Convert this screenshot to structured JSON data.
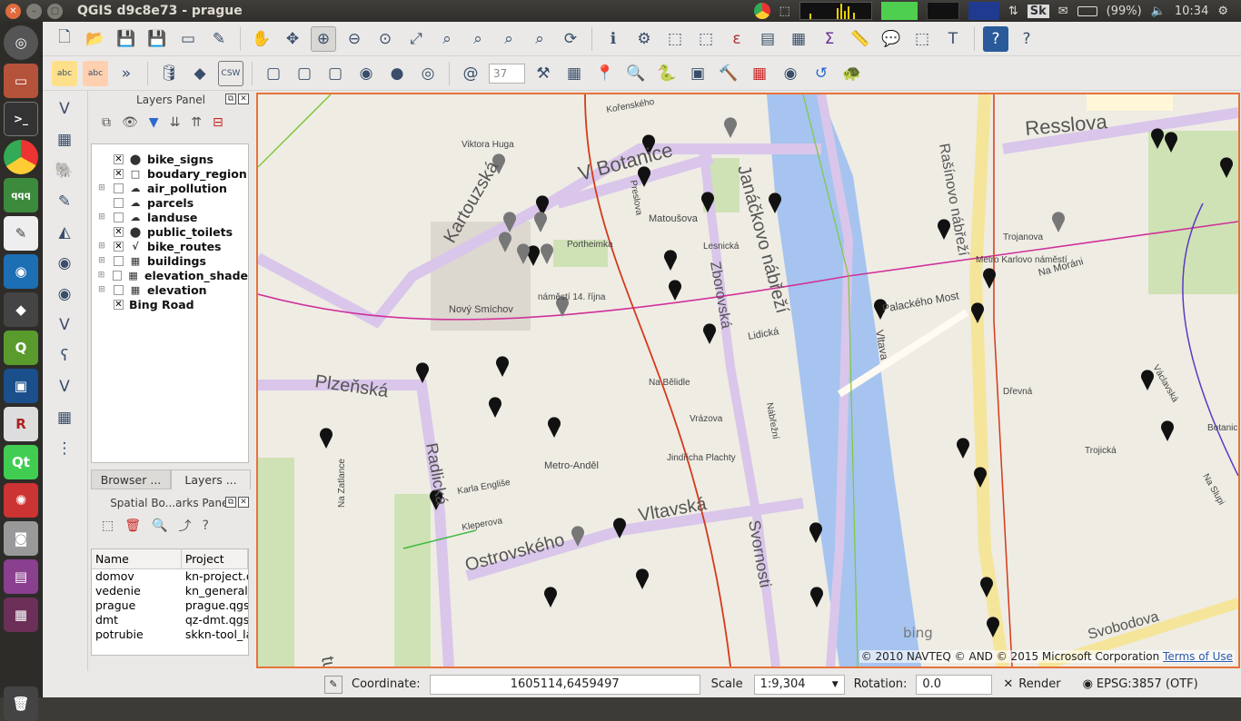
{
  "window": {
    "title": "QGIS d9c8e73 - prague"
  },
  "tray": {
    "battery": "(99%)",
    "time": "10:34",
    "sk_label": "Sk"
  },
  "launcher": {
    "items": [
      "dash-home",
      "files",
      "terminal",
      "chrome",
      "docs",
      "editor",
      "network",
      "vscode",
      "qgis",
      "virtualbox",
      "r",
      "qt",
      "gimp",
      "settings",
      "apps",
      "workspace",
      "trash"
    ]
  },
  "toolbar": {
    "zoom_value": "37"
  },
  "layers_panel": {
    "title": "Layers Panel",
    "layers": [
      {
        "name": "bike_signs",
        "checked": true,
        "icon": "marker-icon",
        "expand": false
      },
      {
        "name": "boudary_region",
        "checked": true,
        "icon": "polygon-outline-icon",
        "expand": false
      },
      {
        "name": "air_pollution",
        "checked": false,
        "icon": "polygon-icon",
        "expand": true
      },
      {
        "name": "parcels",
        "checked": false,
        "icon": "polygon-icon",
        "expand": false
      },
      {
        "name": "landuse",
        "checked": false,
        "icon": "polygon-icon",
        "expand": true
      },
      {
        "name": "public_toilets",
        "checked": true,
        "icon": "marker-icon",
        "expand": false
      },
      {
        "name": "bike_routes",
        "checked": true,
        "icon": "line-icon",
        "expand": true
      },
      {
        "name": "buildings",
        "checked": false,
        "icon": "raster-icon",
        "expand": true
      },
      {
        "name": "elevation_shade",
        "checked": false,
        "icon": "raster-icon",
        "expand": true
      },
      {
        "name": "elevation",
        "checked": false,
        "icon": "raster-icon",
        "expand": true
      },
      {
        "name": "Bing Road",
        "checked": true,
        "icon": "",
        "expand": false
      }
    ]
  },
  "panel_tabs": {
    "browser": "Browser ...",
    "layers": "Layers ..."
  },
  "bookmarks_panel": {
    "title": "Spatial Bo...arks Panel",
    "col_name": "Name",
    "col_project": "Project",
    "rows": [
      {
        "name": "domov",
        "project": "kn-project.q"
      },
      {
        "name": "vedenie",
        "project": "kn_general_"
      },
      {
        "name": "prague",
        "project": "prague.qgs"
      },
      {
        "name": "dmt",
        "project": "qz-dmt.qgs"
      },
      {
        "name": "potrubie",
        "project": "skkn-tool_la"
      }
    ]
  },
  "map": {
    "attribution": "© 2010 NAVTEQ © AND © 2015 Microsoft Corporation",
    "terms": "Terms of Use",
    "bing": "bing",
    "labels": [
      "Resslova",
      "V Botanice",
      "Kartouzská",
      "Janáčkovo nábřeží",
      "Zborovská",
      "Plzeňská",
      "Radlická",
      "Vltavská",
      "Ostrovského",
      "Svornosti",
      "Rašínovo nábřeží",
      "Vltava",
      "Palackého Most",
      "Lidická",
      "Matoušova",
      "Preslova",
      "Nový Smíchov",
      "Metro-Anděl",
      "Metro Karlovo náměstí",
      "Svobodova",
      "Trojanova",
      "Na Moráni",
      "náměstí 14. října",
      "Portheimka",
      "Viktora Huga",
      "Kořenského",
      "Karla Engliše",
      "Kleperova",
      "Na Bělidle",
      "Vrázova",
      "Jindřicha Plachty",
      "Trojická",
      "Na Slupi",
      "Botanická",
      "Václavská",
      "Lesnická",
      "Nábřežní",
      "Dřevná",
      "Na Zatlance",
      "tune"
    ]
  },
  "status": {
    "coordinate_label": "Coordinate:",
    "coordinate": "1605114,6459497",
    "scale_label": "Scale",
    "scale": "1:9,304",
    "rotation_label": "Rotation:",
    "rotation": "0.0",
    "render_label": "Render",
    "crs": "EPSG:3857 (OTF)"
  }
}
